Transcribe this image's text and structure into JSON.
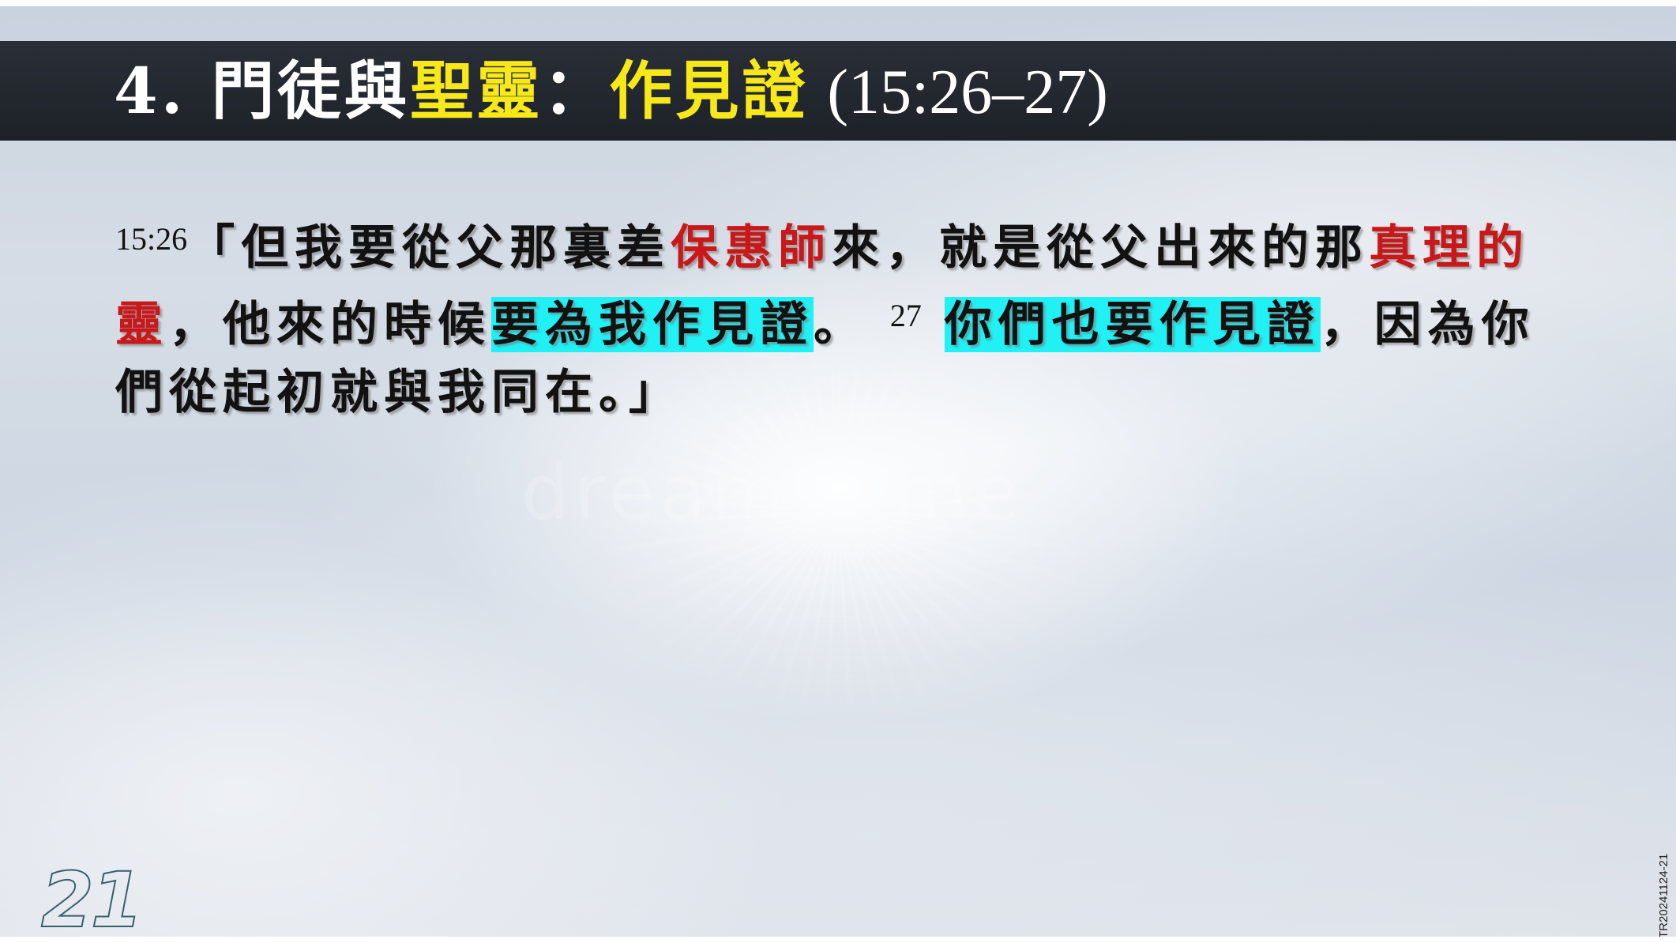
{
  "slide": {
    "title": {
      "number": "4.",
      "part1": "門徒與",
      "highlight1": "聖靈",
      "colon": "：",
      "highlight2": "作見證",
      "reference": "(15:26–27)"
    },
    "verse": {
      "num_26": "15:26",
      "t1": "「但我要從父那裏差",
      "red1": "保惠師",
      "t2": "來，就是從父出來的那",
      "red2": "真理的靈",
      "t3": "，他來的時候",
      "hl1": "要為我作見證",
      "t4": "。",
      "num_27": "27",
      "hl2": "你們也要作見證",
      "t5": "，因為你們從起初就與我同在。」"
    },
    "page_number": "21",
    "code": "TR20241124-21",
    "watermark": "dreamstime"
  },
  "colors": {
    "title_bar": "#1d2128",
    "title_highlight": "#f7e81a",
    "red_text": "#c8181a",
    "cyan_highlight": "#1ff1f5"
  }
}
